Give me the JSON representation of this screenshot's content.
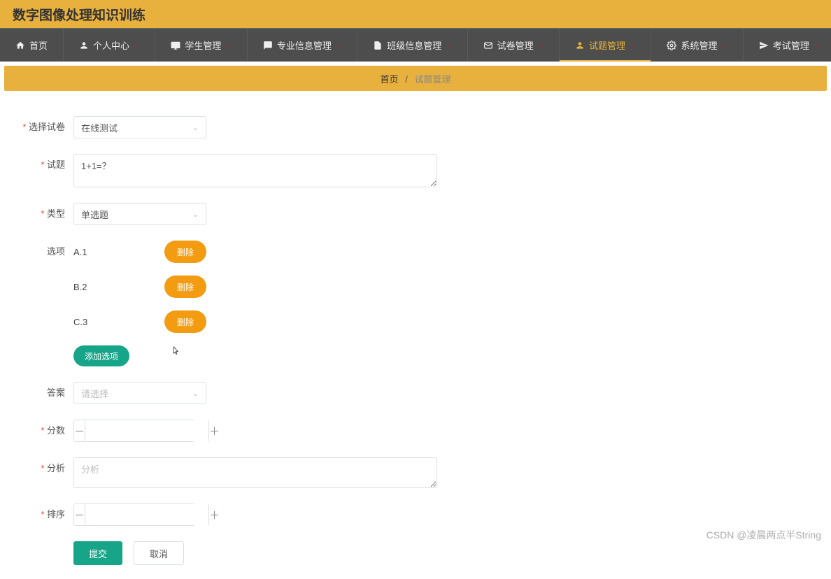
{
  "header": {
    "title": "数字图像处理知识训练"
  },
  "nav": {
    "items": [
      {
        "label": "首页",
        "icon": "home"
      },
      {
        "label": "个人中心",
        "icon": "user",
        "chev": true
      },
      {
        "label": "学生管理",
        "icon": "monitor",
        "chev": true
      },
      {
        "label": "专业信息管理",
        "icon": "chat",
        "chev": true
      },
      {
        "label": "班级信息管理",
        "icon": "doc",
        "chev": true
      },
      {
        "label": "试卷管理",
        "icon": "mail",
        "chev": true
      },
      {
        "label": "试题管理",
        "icon": "user",
        "chev": true,
        "active": true
      },
      {
        "label": "系统管理",
        "icon": "gear",
        "chev": true
      },
      {
        "label": "考试管理",
        "icon": "plane",
        "chev": true
      }
    ]
  },
  "breadcrumb": {
    "home": "首页",
    "sep": "/",
    "current": "试题管理"
  },
  "form": {
    "select_paper": {
      "label": "选择试卷",
      "value": "在线测试"
    },
    "question": {
      "label": "试题",
      "value": "1+1=？"
    },
    "type": {
      "label": "类型",
      "value": "单选题"
    },
    "options_label": "选项",
    "options": [
      {
        "text": "A.1"
      },
      {
        "text": "B.2"
      },
      {
        "text": "C.3"
      }
    ],
    "delete_label": "删除",
    "add_option_label": "添加选项",
    "answer": {
      "label": "答案",
      "placeholder": "请选择"
    },
    "score": {
      "label": "分数",
      "value": ""
    },
    "analysis": {
      "label": "分析",
      "placeholder": "分析",
      "value": ""
    },
    "sort": {
      "label": "排序",
      "value": ""
    },
    "submit": "提交",
    "cancel": "取消"
  },
  "watermark": "CSDN @凌晨两点半String"
}
